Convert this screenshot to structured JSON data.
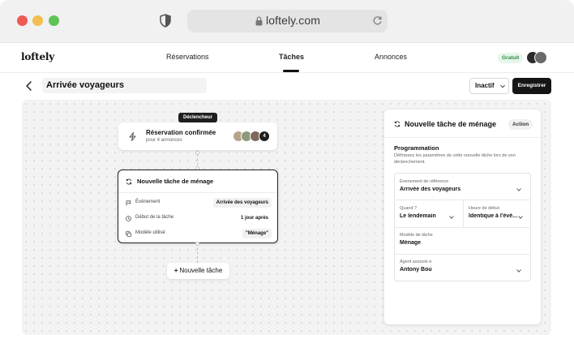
{
  "browser": {
    "url": "loftely.com"
  },
  "nav": {
    "logo": "loftely",
    "links": [
      "Réservations",
      "Tâches",
      "Annonces"
    ],
    "active": "Tâches",
    "plan_badge": "Gratuit"
  },
  "page": {
    "title": "Arrivée voyageurs",
    "status": "Inactif",
    "save_label": "Enregistrer"
  },
  "flow": {
    "trigger_tag": "Déclencheur",
    "trigger": {
      "title": "Réservation confirmée",
      "subtitle": "pour 4 annonces",
      "count": "4"
    },
    "task": {
      "title": "Nouvelle tâche de ménage",
      "rows": [
        {
          "label": "Événement",
          "value": "Arrivée des voyageurs",
          "icon": "flag-icon"
        },
        {
          "label": "Début de la tâche",
          "value": "1 jour après",
          "icon": "clock-icon"
        },
        {
          "label": "Modèle utilisé",
          "value": "\"Ménage\"",
          "icon": "copy-icon"
        }
      ]
    },
    "add_task_label": "Nouvelle tâche"
  },
  "panel": {
    "title": "Nouvelle tâche de ménage",
    "badge": "Action",
    "section_title": "Programmation",
    "section_desc": "Définissez les paramètres de cette nouvelle tâche lors de son déclenchement.",
    "fields": {
      "event": {
        "label": "Évenement de référence",
        "value": "Arrivée des voyageurs"
      },
      "when": {
        "label": "Quand ?",
        "value": "Le lendemain"
      },
      "start_time": {
        "label": "Heure de début",
        "value": "Identique à l'évé..."
      },
      "template": {
        "label": "Modèle de tâche",
        "value": "Ménage"
      },
      "agent": {
        "label": "Agent associé·e",
        "value": "Antony Bou"
      }
    }
  },
  "colors": {
    "accent_dark": "#151515",
    "badge_green_bg": "#e6f6ea",
    "badge_green_text": "#2f8a46",
    "canvas_bg": "#f3f3f3"
  }
}
